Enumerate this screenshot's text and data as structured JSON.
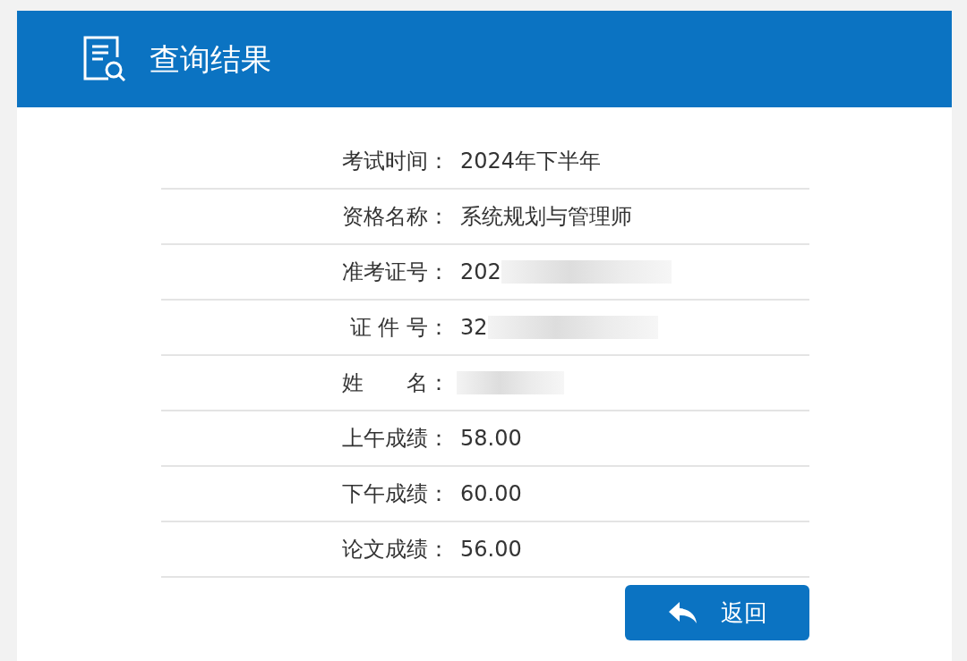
{
  "header": {
    "title": "查询结果"
  },
  "rows": [
    {
      "label": "考试时间：",
      "value": "2024年下半年",
      "redacted": false
    },
    {
      "label": "资格名称：",
      "value": "系统规划与管理师",
      "redacted": false
    },
    {
      "label": "准考证号：",
      "value": "202",
      "redacted": true
    },
    {
      "label": "证 件 号：",
      "value": "32",
      "redacted": true
    },
    {
      "label": "姓　　名：",
      "redacted": true
    },
    {
      "label": "上午成绩：",
      "value": "58.00",
      "redacted": false
    },
    {
      "label": "下午成绩：",
      "value": "60.00",
      "redacted": false
    },
    {
      "label": "论文成绩：",
      "value": "56.00",
      "redacted": false
    }
  ],
  "button": {
    "label": "返回"
  }
}
